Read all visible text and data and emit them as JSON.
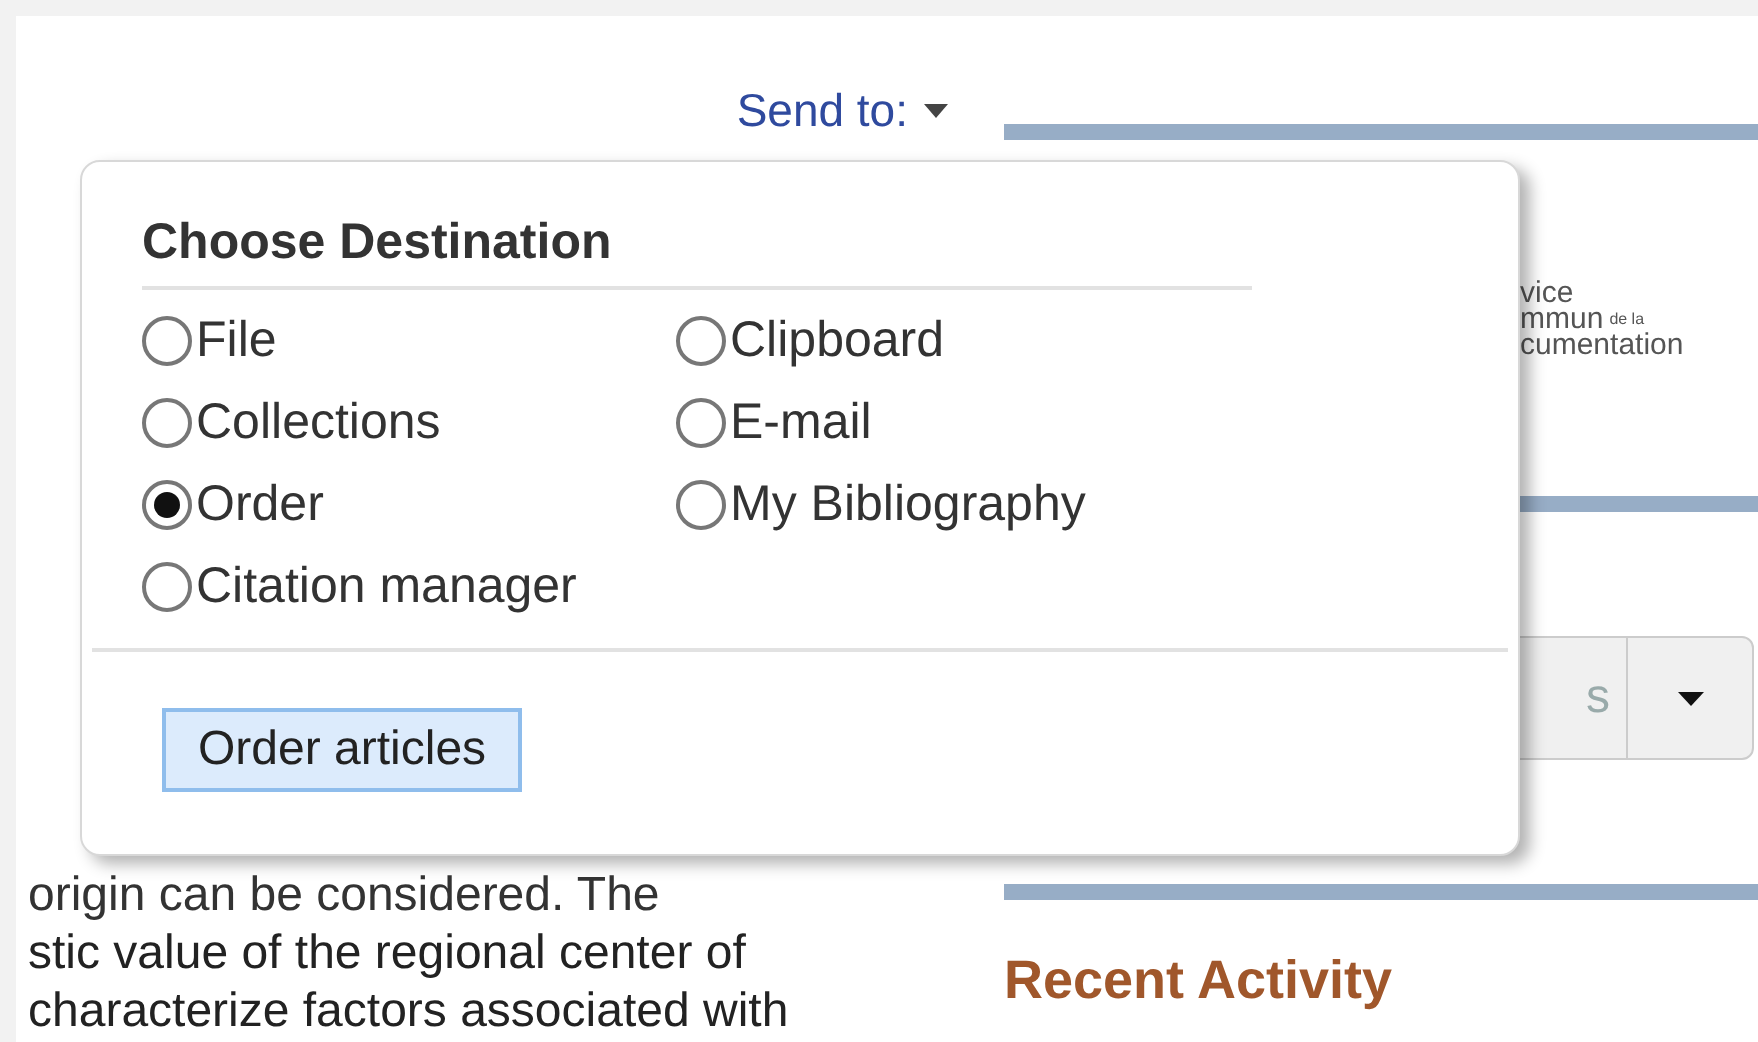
{
  "page": {
    "send_to": "Send to:",
    "abstract_lines": [
      "origin can be considered. The",
      "stic value of the regional center of",
      "characterize factors associated with"
    ]
  },
  "sidebar": {
    "logo_lines": [
      "vice",
      "mmun",
      "de la",
      "cumentation"
    ],
    "button_fragment": "s",
    "recent_activity": "Recent Activity"
  },
  "dialog": {
    "title": "Choose Destination",
    "options": [
      {
        "label": "File",
        "selected": false
      },
      {
        "label": "Clipboard",
        "selected": false
      },
      {
        "label": "Collections",
        "selected": false
      },
      {
        "label": "E-mail",
        "selected": false
      },
      {
        "label": "Order",
        "selected": true
      },
      {
        "label": "My Bibliography",
        "selected": false
      },
      {
        "label": "Citation manager",
        "selected": false
      }
    ],
    "action": "Order articles"
  }
}
